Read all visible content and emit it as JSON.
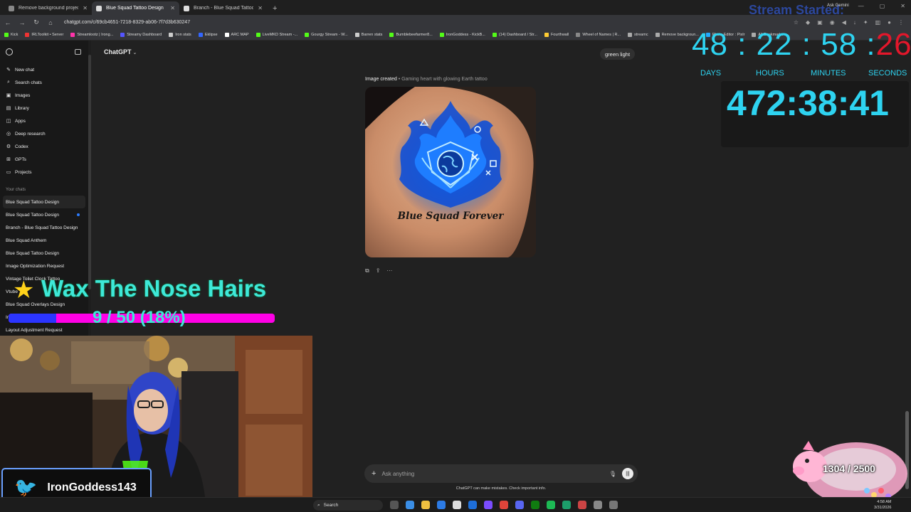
{
  "browser": {
    "tabs": [
      {
        "title": "Remove background project - I",
        "active": false
      },
      {
        "title": "Blue Squad Tattoo Design",
        "active": true
      },
      {
        "title": "Branch - Blue Squad Tattoo De",
        "active": false
      }
    ],
    "new_tab": "+",
    "url": "chatgpt.com/c/69cb4651-7218-8329-ab06-7f7d3b630247",
    "bookmarks": [
      "Kick",
      "IRLToolkit • Server",
      "Streamlootz | Irong...",
      "Streamy Dashboard",
      "Iron stats",
      "Eklipse",
      "ARC MAP",
      "LiveMKD Stream -...",
      "Gourgy Stream - W...",
      "Barren stats",
      "Bumblebeefarmer8...",
      "IronGoddess - KickB...",
      "(14) Dashboard / Str...",
      "Fourthwall",
      "Wheel of Names | R...",
      "streamc",
      "Remove backgroun...",
      "Photo Editor : Pixlr",
      "All Bookmarks"
    ]
  },
  "sidebar": {
    "nav": [
      {
        "icon": "new-chat-icon",
        "glyph": "✎",
        "label": "New chat"
      },
      {
        "icon": "search-icon",
        "glyph": "⌕",
        "label": "Search chats"
      },
      {
        "icon": "images-icon",
        "glyph": "▣",
        "label": "Images"
      },
      {
        "icon": "library-icon",
        "glyph": "▤",
        "label": "Library"
      },
      {
        "icon": "apps-icon",
        "glyph": "◫",
        "label": "Apps"
      },
      {
        "icon": "deep-research-icon",
        "glyph": "◎",
        "label": "Deep research"
      },
      {
        "icon": "codex-icon",
        "glyph": "⚙",
        "label": "Codex"
      },
      {
        "icon": "gpts-icon",
        "glyph": "⊞",
        "label": "GPTs"
      },
      {
        "icon": "projects-icon",
        "glyph": "▭",
        "label": "Projects"
      }
    ],
    "section_label": "Your chats",
    "chats": [
      "Blue Squad Tattoo Design",
      "Blue Squad Tattoo Design",
      "Branch - Blue Squad Tattoo Design",
      "Blue Squad Anthem",
      "Blue Squad Tattoo Design",
      "Image Optimization Request",
      "Vintage Toilet Clock Tattoo",
      "Vtube",
      "Blue Squad Overlays Design",
      "Im",
      "Layout Adjustment Request"
    ]
  },
  "main": {
    "model_name": "ChatGPT",
    "user_message": "green light",
    "image_caption_prefix": "Image created",
    "image_caption_title": "• Gaming heart with glowing Earth tattoo",
    "tattoo_text": "Blue Squad Forever",
    "composer_placeholder": "Ask anything",
    "disclaimer": "ChatGPT can make mistakes. Check important info."
  },
  "overlays": {
    "stream_started": "Stream Started:",
    "ask_gemini": "Ask Gemini",
    "timer_main": "48 : 22 : 58 :",
    "timer_seconds": "26",
    "labels": [
      "DAYS",
      "HOURS",
      "MINUTES",
      "SECONDS"
    ],
    "big_timer": "472:38:41",
    "goal_title": "Wax The Nose Hairs",
    "goal_count": "9 / 50 (18%)",
    "goal_fraction": 0.18,
    "twitter_handle": "IronGoddess143",
    "pig_counter": "1304 / 2500"
  },
  "taskbar": {
    "search": "Search",
    "time": "4:58 AM",
    "date": "3/31/2026"
  },
  "colors": {
    "accent_cyan": "#2ed3f0",
    "seconds_red": "#e3172b",
    "goal_pink": "#ff00e6",
    "goal_blue": "#2b35ff"
  }
}
